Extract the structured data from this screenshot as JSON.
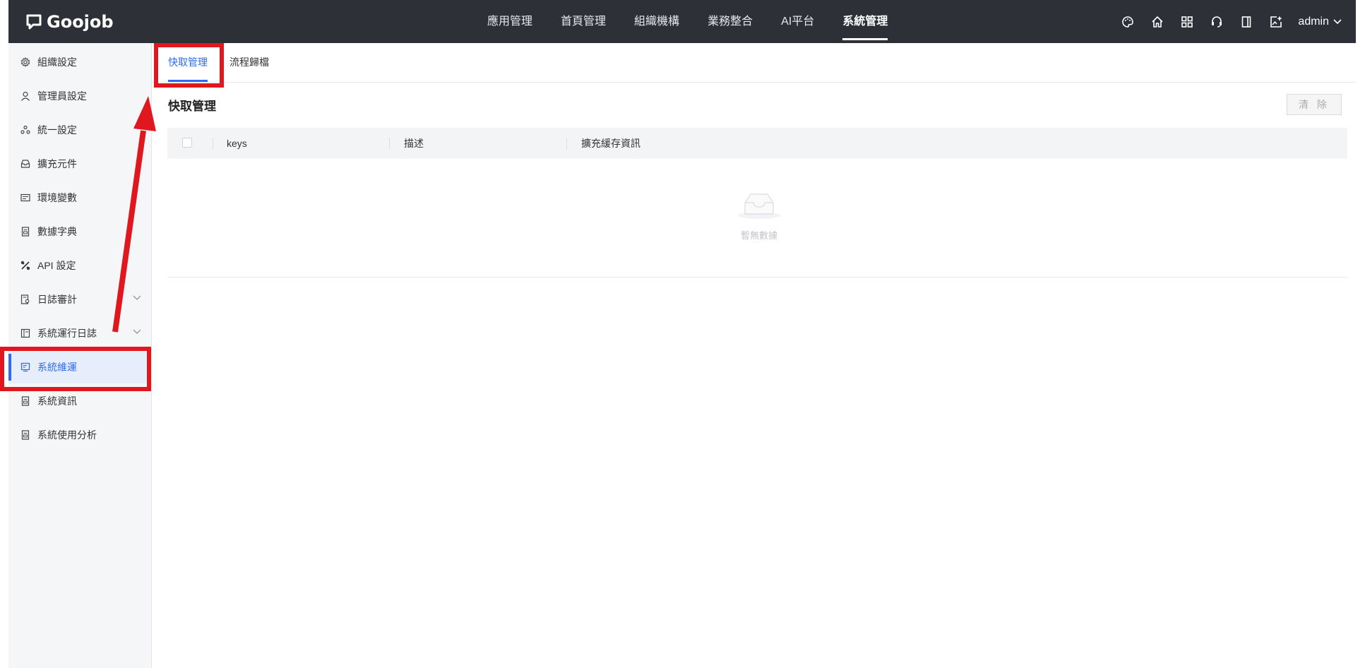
{
  "brand": {
    "name": "Goojob"
  },
  "topnav": {
    "items": [
      "應用管理",
      "首頁管理",
      "組織機構",
      "業務整合",
      "AI平台",
      "系統管理"
    ],
    "active": "系統管理"
  },
  "topicons": [
    "palette-icon",
    "home-icon",
    "apps-icon",
    "support-icon",
    "book-icon",
    "image-edit-icon"
  ],
  "user": {
    "name": "admin"
  },
  "sidebar": {
    "items": [
      {
        "label": "組織設定",
        "icon": "gear-icon"
      },
      {
        "label": "管理員設定",
        "icon": "user-icon"
      },
      {
        "label": "統一設定",
        "icon": "cycle-icon"
      },
      {
        "label": "擴充元件",
        "icon": "inbox-icon"
      },
      {
        "label": "環境變數",
        "icon": "terminal-icon"
      },
      {
        "label": "數據字典",
        "icon": "document-icon"
      },
      {
        "label": "API 設定",
        "icon": "tools-icon"
      },
      {
        "label": "日誌審計",
        "icon": "audit-icon",
        "expandable": true
      },
      {
        "label": "系統運行日誌",
        "icon": "log-icon",
        "expandable": true
      },
      {
        "label": "系統維運",
        "icon": "maintenance-icon",
        "active": true
      },
      {
        "label": "系統資訊",
        "icon": "info-doc-icon"
      },
      {
        "label": "系統使用分析",
        "icon": "analysis-doc-icon"
      }
    ]
  },
  "tabs": {
    "items": [
      "快取管理",
      "流程歸檔"
    ],
    "active": "快取管理"
  },
  "main": {
    "title": "快取管理",
    "clear_label": "清 除",
    "table": {
      "columns": [
        "keys",
        "描述",
        "擴充緩存資訊"
      ],
      "rows": [],
      "empty_text": "暫無數據"
    }
  },
  "annotation": {
    "color": "#e0171f"
  },
  "colors": {
    "accent": "#2f6bf0",
    "topbar": "#2d3037"
  }
}
